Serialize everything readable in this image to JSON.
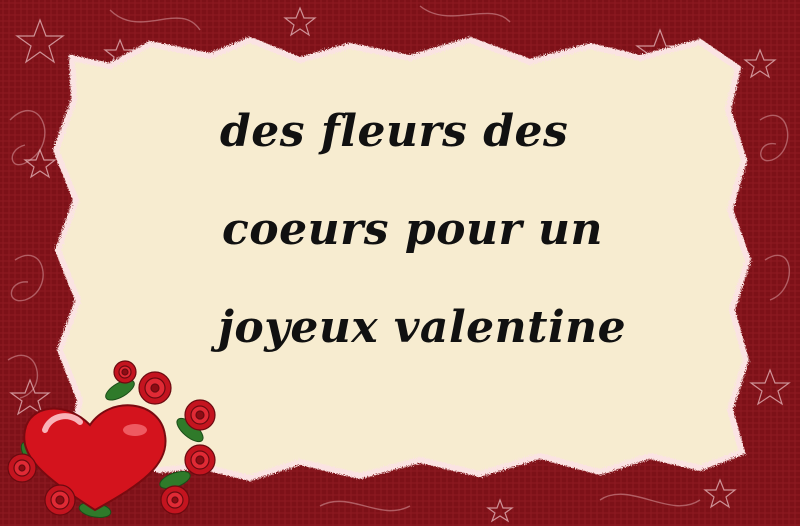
{
  "card": {
    "lines": [
      "des fleurs des",
      "coeurs pour un",
      "joyeux valentine"
    ],
    "colors": {
      "frame": "#7a1016",
      "parchment": "#f7ecd0",
      "text": "#111111",
      "heart": "#d4131d",
      "rose": "#c4141f",
      "leaf": "#2f7a2a"
    },
    "icons": [
      "star-icon",
      "heart-icon",
      "rose-icon",
      "swirl-icon"
    ]
  }
}
